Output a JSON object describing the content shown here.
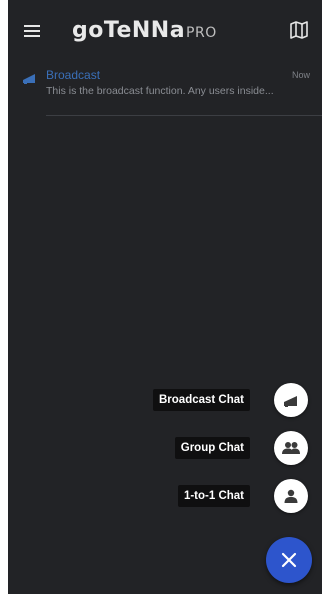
{
  "app": {
    "logo_main": "goTeNNa",
    "logo_sub": "PRO"
  },
  "conversations": [
    {
      "title": "Broadcast",
      "time": "Now",
      "preview": "This is the broadcast function. Any users inside..."
    }
  ],
  "fab_menu": {
    "items": [
      {
        "label": "Broadcast Chat",
        "icon": "megaphone-icon"
      },
      {
        "label": "Group Chat",
        "icon": "group-icon"
      },
      {
        "label": "1-to-1 Chat",
        "icon": "person-icon"
      }
    ],
    "close_icon": "close-icon"
  },
  "colors": {
    "background": "#222326",
    "accent": "#2d55cc",
    "title_blue": "#3a6fb8"
  }
}
